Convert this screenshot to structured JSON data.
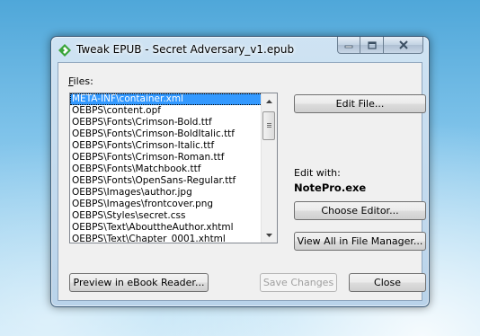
{
  "window": {
    "title": "Tweak EPUB - Secret Adversary_v1.epub",
    "app_icon": "epub-icon"
  },
  "files": {
    "label_prefix": "F",
    "label_rest": "iles:",
    "items": [
      "META-INF\\container.xml",
      "OEBPS\\content.opf",
      "OEBPS\\Fonts\\Crimson-Bold.ttf",
      "OEBPS\\Fonts\\Crimson-BoldItalic.ttf",
      "OEBPS\\Fonts\\Crimson-Italic.ttf",
      "OEBPS\\Fonts\\Crimson-Roman.ttf",
      "OEBPS\\Fonts\\Matchbook.ttf",
      "OEBPS\\Fonts\\OpenSans-Regular.ttf",
      "OEBPS\\Images\\author.jpg",
      "OEBPS\\Images\\frontcover.png",
      "OEBPS\\Styles\\secret.css",
      "OEBPS\\Text\\AbouttheAuthor.xhtml",
      "OEBPS\\Text\\Chapter_0001.xhtml"
    ],
    "selected_index": 0
  },
  "buttons": {
    "edit_file": "Edit File...",
    "choose_editor": "Choose Editor...",
    "view_all": "View All in File Manager...",
    "preview": "Preview in eBook Reader...",
    "save_changes": "Save Changes",
    "close": "Close"
  },
  "editor": {
    "edit_with_label": "Edit with:",
    "name": "NotePro.exe"
  },
  "colors": {
    "selection": "#3399ff",
    "dialog_bg": "#f0f0f0",
    "icon_green": "#3aa53a"
  }
}
